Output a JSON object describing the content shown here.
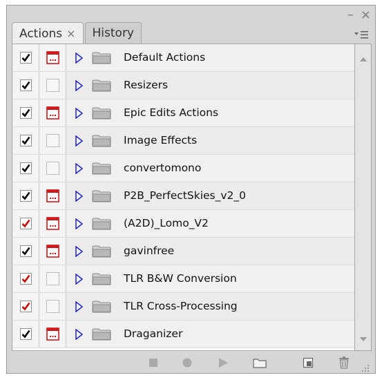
{
  "window": {
    "minimize_symbol": "–",
    "close_symbol": "×"
  },
  "tabs": [
    {
      "label": "Actions",
      "close": "×",
      "active": true
    },
    {
      "label": "History",
      "active": false
    }
  ],
  "panel_menu_icon": "panel-menu-icon",
  "actions": [
    {
      "label": "Default Actions",
      "checked": true,
      "check_color": "#000000",
      "dialog": true
    },
    {
      "label": "Resizers",
      "checked": true,
      "check_color": "#000000",
      "dialog": false
    },
    {
      "label": "Epic Edits Actions",
      "checked": true,
      "check_color": "#000000",
      "dialog": true
    },
    {
      "label": "Image Effects",
      "checked": true,
      "check_color": "#000000",
      "dialog": false
    },
    {
      "label": "convertomono",
      "checked": true,
      "check_color": "#000000",
      "dialog": false
    },
    {
      "label": "P2B_PerfectSkies_v2_0",
      "checked": true,
      "check_color": "#000000",
      "dialog": true
    },
    {
      "label": "(A2D)_Lomo_V2",
      "checked": true,
      "check_color": "#d40000",
      "dialog": true
    },
    {
      "label": "gavinfree",
      "checked": true,
      "check_color": "#000000",
      "dialog": true
    },
    {
      "label": "TLR B&W Conversion",
      "checked": true,
      "check_color": "#d40000",
      "dialog": false
    },
    {
      "label": "TLR Cross-Processing",
      "checked": true,
      "check_color": "#d40000",
      "dialog": false
    },
    {
      "label": "Draganizer",
      "checked": true,
      "check_color": "#000000",
      "dialog": true
    }
  ],
  "colors": {
    "expander": "#2b2bd0",
    "dialog_red": "#d01818",
    "folder": "#b8b8b8"
  },
  "bottom_buttons": [
    {
      "name": "stop-button",
      "icon": "stop-icon"
    },
    {
      "name": "record-button",
      "icon": "record-icon"
    },
    {
      "name": "play-button",
      "icon": "play-icon"
    },
    {
      "name": "new-set-button",
      "icon": "folder-icon"
    },
    {
      "name": "new-action-button",
      "icon": "new-action-icon"
    },
    {
      "name": "delete-button",
      "icon": "trash-icon"
    }
  ]
}
